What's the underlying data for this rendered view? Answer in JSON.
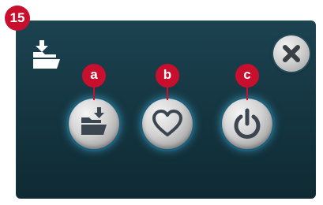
{
  "step_number": "15",
  "icons": {
    "header": "folder-import-icon",
    "close": "close-icon",
    "button_a": "folder-import-icon",
    "button_b": "heart-icon",
    "button_c": "power-icon"
  },
  "callouts": {
    "a": "a",
    "b": "b",
    "c": "c"
  },
  "colors": {
    "panel": "#143540",
    "badge": "#c8102e",
    "button_glow": "#46aad2",
    "icon": "#3b4650"
  }
}
